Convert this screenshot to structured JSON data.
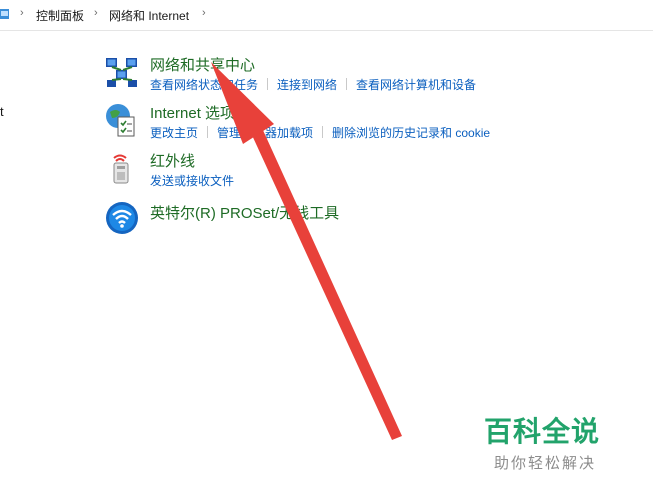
{
  "breadcrumb": {
    "items": [
      "控制面板",
      "网络和 Internet"
    ],
    "separator": "›"
  },
  "left_pane": {
    "truncated_text": "t"
  },
  "categories": [
    {
      "title": "网络和共享中心",
      "icon": "network-sharing-icon",
      "links": [
        "查看网络状态和任务",
        "连接到网络",
        "查看网络计算机和设备"
      ]
    },
    {
      "title": "Internet 选项",
      "icon": "internet-options-icon",
      "links": [
        "更改主页",
        "管理浏览器加载项",
        "删除浏览的历史记录和 cookie"
      ]
    },
    {
      "title": "红外线",
      "icon": "infrared-icon",
      "links": [
        "发送或接收文件"
      ]
    },
    {
      "title": "英特尔(R) PROSet/无线工具",
      "icon": "intel-wireless-icon",
      "links": []
    }
  ],
  "annotation": {
    "type": "arrow",
    "color": "#e8413a"
  },
  "watermark": {
    "title": "百科全说",
    "subtitle": "助你轻松解决"
  },
  "colors": {
    "category_title": "#1e6b25",
    "link": "#0b5fbf",
    "watermark": "#22a36b"
  }
}
